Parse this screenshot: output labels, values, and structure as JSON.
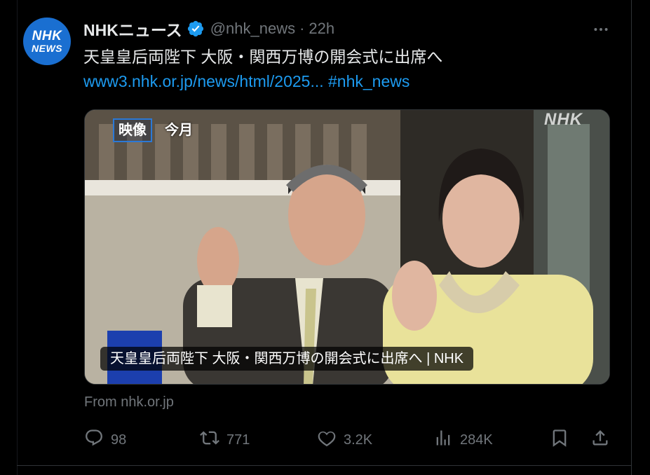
{
  "account": {
    "avatar_line1": "NHK",
    "avatar_line2": "NEWS",
    "display_name": "NHKニュース",
    "handle": "@nhk_news",
    "separator": "·",
    "time": "22h",
    "verified_icon": "verified-badge-icon"
  },
  "tweet": {
    "text": "天皇皇后両陛下 大阪・関西万博の開会式に出席へ",
    "link_url": "www3.nhk.or.jp/news/html/2025...",
    "hashtag": "#nhk_news"
  },
  "media": {
    "tag_label": "映像",
    "tag_text": "今月",
    "watermark": "NHK",
    "caption": "天皇皇后両陛下 大阪・関西万博の開会式に出席へ | NHK",
    "source": "From nhk.or.jp"
  },
  "actions": {
    "reply": {
      "icon": "reply-icon",
      "count": "98"
    },
    "repost": {
      "icon": "repost-icon",
      "count": "771"
    },
    "like": {
      "icon": "heart-icon",
      "count": "3.2K"
    },
    "views": {
      "icon": "views-icon",
      "count": "284K"
    },
    "bookmark": {
      "icon": "bookmark-icon"
    },
    "share": {
      "icon": "share-icon"
    }
  },
  "colors": {
    "background": "#000000",
    "text": "#e7e9ea",
    "muted": "#71767b",
    "link": "#1d9bf0",
    "avatar": "#1a6fd1"
  }
}
